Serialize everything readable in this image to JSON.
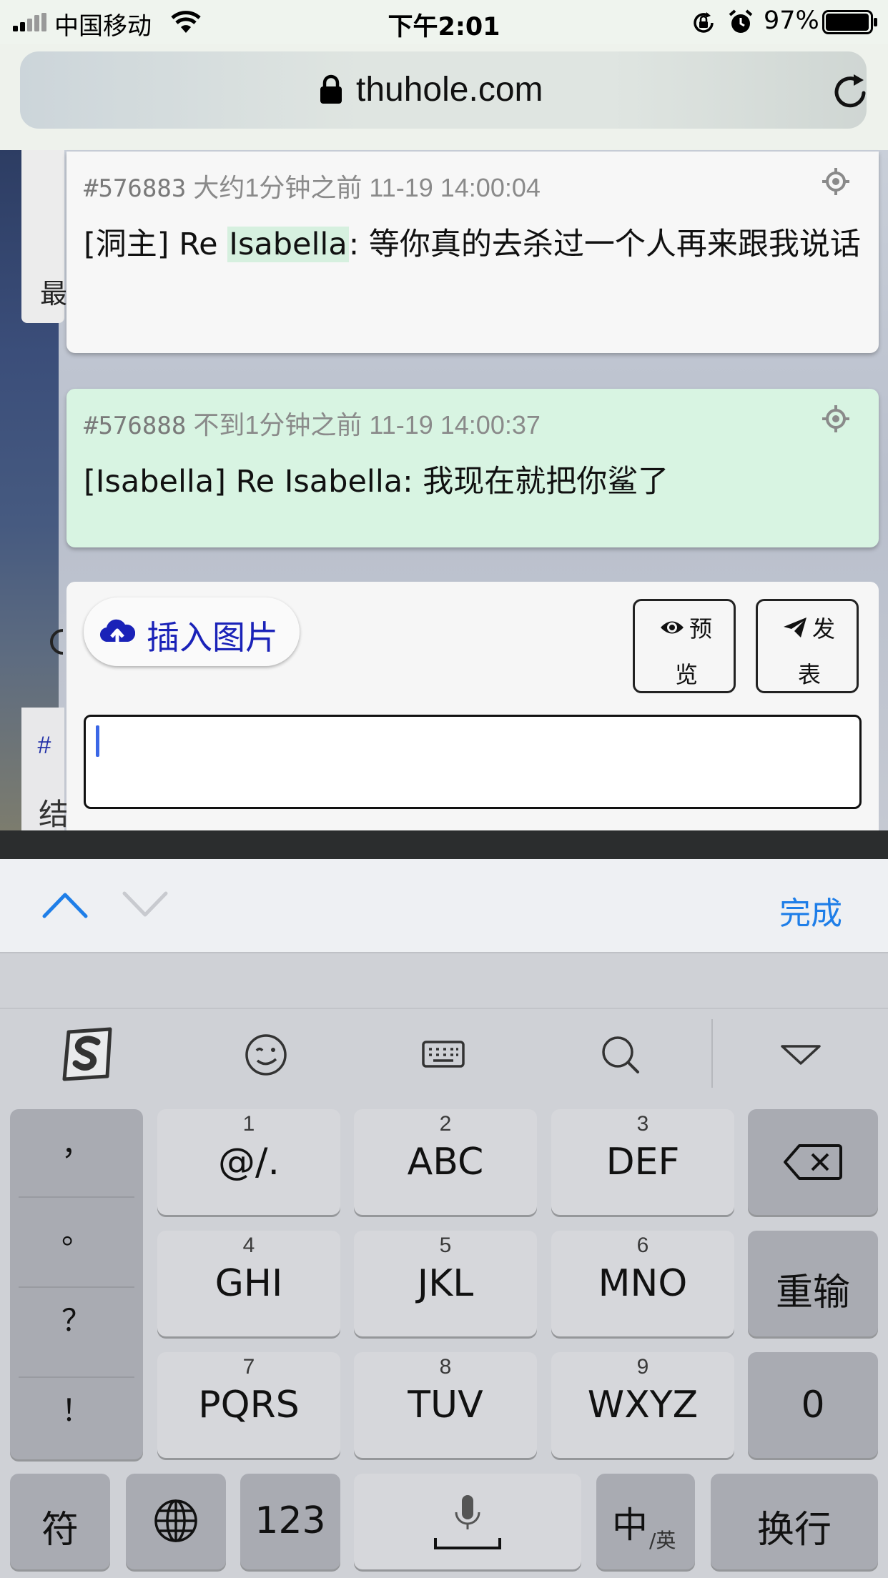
{
  "status_bar": {
    "carrier": "中国移动",
    "time": "下午2:01",
    "battery": "97%"
  },
  "browser": {
    "url": "thuhole.com"
  },
  "background_snippets": {
    "left_char": "最",
    "hash": "#",
    "bottom_char": "结"
  },
  "posts": [
    {
      "pid": "#576883",
      "relative_time": "大约1分钟之前",
      "timestamp": "11-19 14:00:04",
      "body_prefix": "[洞主] Re ",
      "body_highlight": "Isabella",
      "body_suffix": ": 等你真的去杀过一个人再来跟我说话"
    },
    {
      "pid": "#576888",
      "relative_time": "不到1分钟之前",
      "timestamp": "11-19 14:00:37",
      "body": "[Isabella] Re Isabella: 我现在就把你鲨了"
    }
  ],
  "composer": {
    "upload_label": "插入图片",
    "preview_c1": "预",
    "preview_c2": "览",
    "post_c1": "发",
    "post_c2": "表",
    "input_value": ""
  },
  "keyboard_toolbar": {
    "done_label": "完成"
  },
  "ime_icons": [
    "sogou-logo-icon",
    "emoji-icon",
    "keyboard-icon",
    "search-icon",
    "collapse-triangle-icon"
  ],
  "keyboard": {
    "punctuation": [
      "，",
      "。",
      "？",
      "！"
    ],
    "keys": [
      {
        "num": "1",
        "label": "@/."
      },
      {
        "num": "2",
        "label": "ABC"
      },
      {
        "num": "3",
        "label": "DEF"
      },
      {
        "num": "4",
        "label": "GHI"
      },
      {
        "num": "5",
        "label": "JKL"
      },
      {
        "num": "6",
        "label": "MNO"
      },
      {
        "num": "7",
        "label": "PQRS"
      },
      {
        "num": "8",
        "label": "TUV"
      },
      {
        "num": "9",
        "label": "WXYZ"
      }
    ],
    "retype": "重输",
    "zero": "0",
    "symbols": "符",
    "numbers": "123",
    "lang_main": "中",
    "lang_sub": "/英",
    "return": "换行"
  },
  "colors": {
    "highlight_card": "#d8f4e2",
    "link_blue": "#1a22b8",
    "done_blue": "#1e7ee8"
  }
}
